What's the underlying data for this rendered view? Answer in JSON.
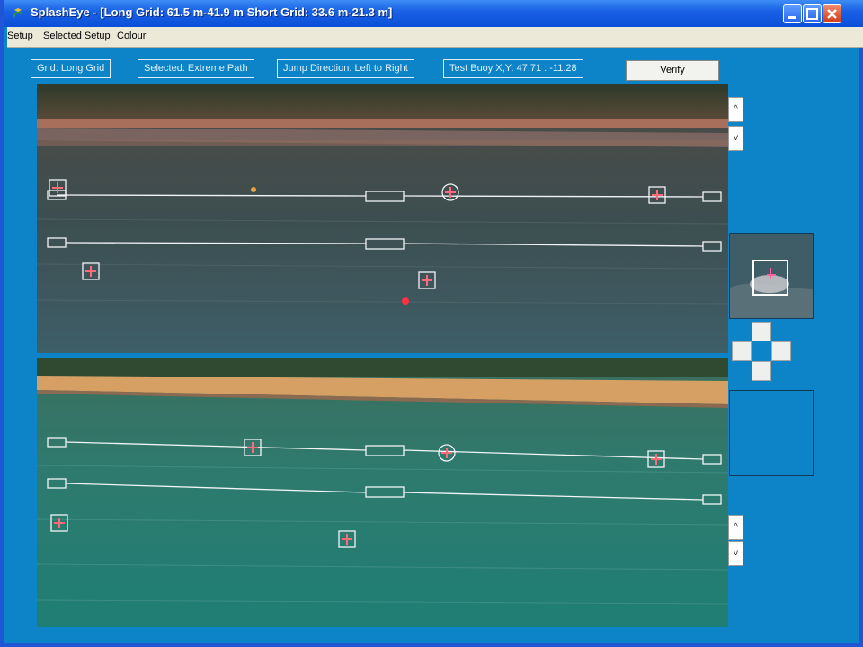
{
  "window": {
    "title": "SplashEye - [Long Grid: 61.5 m-41.9 m   Short Grid: 33.6 m-21.3 m]",
    "app_icon": "splasheye-logo-icon",
    "buttons": [
      "minimize-icon",
      "maximize-icon",
      "close-icon"
    ]
  },
  "menu": {
    "items": [
      "Setup",
      "Selected Setup",
      "Colour"
    ]
  },
  "toolbar": {
    "grid": "Grid:  Long Grid",
    "selected": "Selected: Extreme Path",
    "jump_direction": "Jump Direction:  Left to Right",
    "test_buoy": "Test Buoy X,Y:  47.71 : -11.28",
    "verify_label": "Verify"
  },
  "scroll": {
    "up": "^",
    "down": "v"
  },
  "colors": {
    "window_bg": "#0e84c8",
    "titlebar": "#1a62e6",
    "grid_line": "#f2f4f8",
    "marker": "#ff4a6a"
  }
}
